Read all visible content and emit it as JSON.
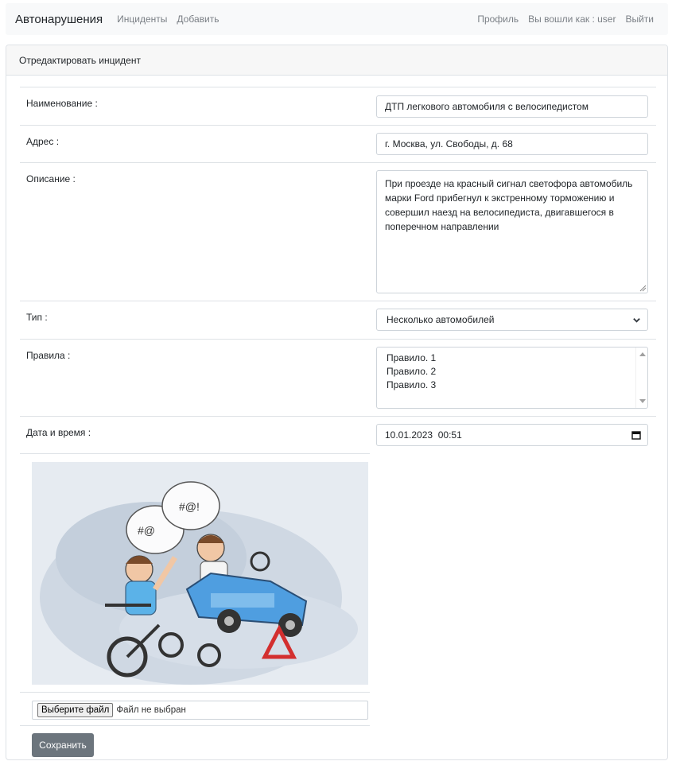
{
  "navbar": {
    "brand": "Автонарушения",
    "links": [
      "Инциденты",
      "Добавить"
    ],
    "right_links": [
      "Профиль",
      "Вы вошли как : user",
      "Выйти"
    ]
  },
  "card": {
    "header": "Отредактировать инцидент"
  },
  "form": {
    "name_label": "Наименование :",
    "name_value": "ДТП легкового автомобиля с велосипедистом",
    "address_label": "Адрес :",
    "address_value": "г. Москва, ул. Свободы, д. 68",
    "description_label": "Описание :",
    "description_value": "При проезде на красный сигнал светофора автомобиль марки Ford прибегнул к экстренному торможению и совершил наезд на велосипедиста, двигавшегося в поперечном направлении",
    "type_label": "Тип :",
    "type_value": "Несколько автомобилей",
    "rules_label": "Правила :",
    "rules_options": [
      "Правило. 1",
      "Правило. 2",
      "Правило. 3"
    ],
    "datetime_label": "Дата и время :",
    "datetime_value": "10.01.2023  00:51",
    "file_button": "Выберите файл",
    "file_status": "Файл не выбран",
    "save_button": "Сохранить"
  },
  "colors": {
    "save_button_bg": "#6c757d",
    "navbar_bg": "#f8f9fa",
    "border": "#dee2e6"
  },
  "icons": [
    "chevron-down-icon",
    "calendar-icon",
    "resize-grip-icon",
    "scroll-up-icon",
    "scroll-down-icon"
  ]
}
